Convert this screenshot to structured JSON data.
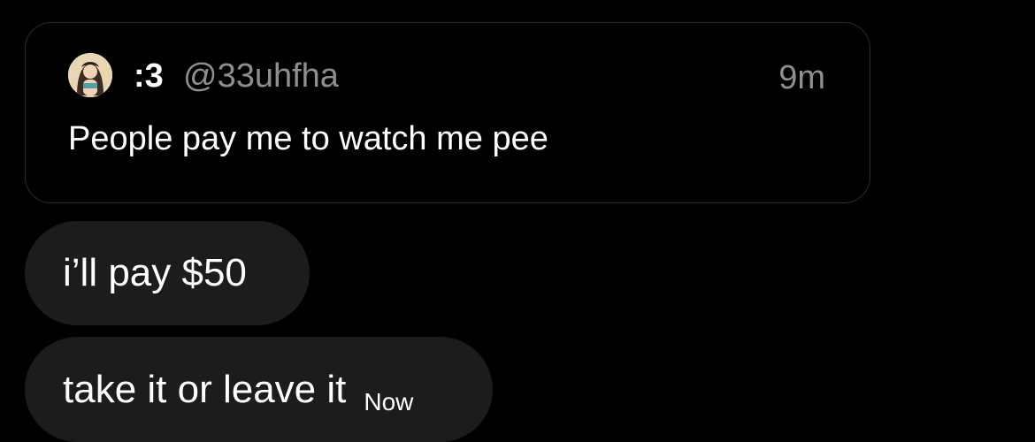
{
  "quoted_post": {
    "display_name": ":3",
    "handle": "@33uhfha",
    "time": "9m",
    "text": "People pay me to watch me pee",
    "avatar_icon": "profile-avatar"
  },
  "messages": [
    {
      "text": "i’ll pay $50",
      "time": ""
    },
    {
      "text": "take it or leave it",
      "time": "Now"
    }
  ],
  "colors": {
    "background": "#000000",
    "bubble": "#1c1c1e",
    "card_border": "#2c2c2e",
    "secondary_text": "#8e8e93",
    "primary_text": "#ffffff"
  }
}
